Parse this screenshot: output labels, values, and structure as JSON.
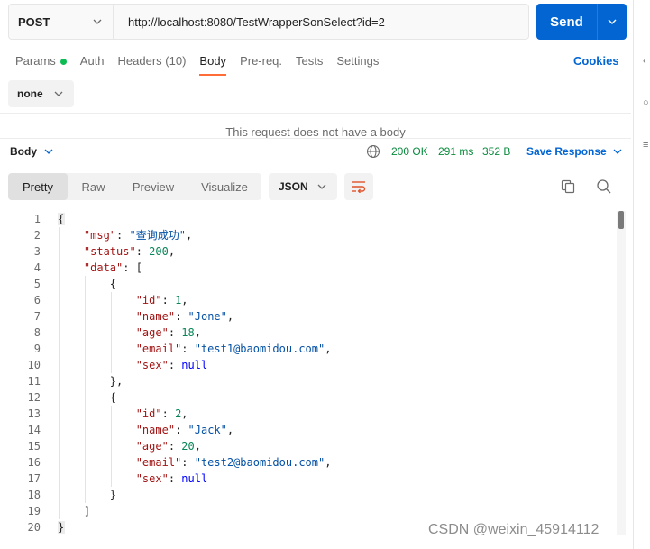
{
  "request": {
    "method": "POST",
    "url": "http://localhost:8080/TestWrapperSonSelect?id=2",
    "send_label": "Send",
    "tabs": [
      {
        "label": "Params"
      },
      {
        "label": "Auth"
      },
      {
        "label": "Headers (10)"
      },
      {
        "label": "Body"
      },
      {
        "label": "Pre-req."
      },
      {
        "label": "Tests"
      },
      {
        "label": "Settings"
      }
    ],
    "active_tab": "Body",
    "cookies_label": "Cookies",
    "body_type": "none",
    "no_body_message": "This request does not have a body"
  },
  "response": {
    "section_label": "Body",
    "status": "200 OK",
    "time": "291 ms",
    "size": "352 B",
    "save_label": "Save Response",
    "view_tabs": [
      "Pretty",
      "Raw",
      "Preview",
      "Visualize"
    ],
    "active_view": "Pretty",
    "format": "JSON",
    "lines": [
      {
        "n": "1",
        "text": "{"
      },
      {
        "n": "2",
        "text": "    \"msg\": \"查询成功\","
      },
      {
        "n": "3",
        "text": "    \"status\": 200,"
      },
      {
        "n": "4",
        "text": "    \"data\": ["
      },
      {
        "n": "5",
        "text": "        {"
      },
      {
        "n": "6",
        "text": "            \"id\": 1,"
      },
      {
        "n": "7",
        "text": "            \"name\": \"Jone\","
      },
      {
        "n": "8",
        "text": "            \"age\": 18,"
      },
      {
        "n": "9",
        "text": "            \"email\": \"test1@baomidou.com\","
      },
      {
        "n": "10",
        "text": "            \"sex\": null"
      },
      {
        "n": "11",
        "text": "        },"
      },
      {
        "n": "12",
        "text": "        {"
      },
      {
        "n": "13",
        "text": "            \"id\": 2,"
      },
      {
        "n": "14",
        "text": "            \"name\": \"Jack\","
      },
      {
        "n": "15",
        "text": "            \"age\": 20,"
      },
      {
        "n": "16",
        "text": "            \"email\": \"test2@baomidou.com\","
      },
      {
        "n": "17",
        "text": "            \"sex\": null"
      },
      {
        "n": "18",
        "text": "        }"
      },
      {
        "n": "19",
        "text": "    ]"
      },
      {
        "n": "20",
        "text": "}"
      }
    ]
  },
  "watermark": "CSDN @weixin_45914112",
  "colors": {
    "accent_blue": "#0265d2",
    "tab_underline": "#ff6c37",
    "status_green": "#0a8a3e",
    "params_dot": "#0cbb52"
  }
}
